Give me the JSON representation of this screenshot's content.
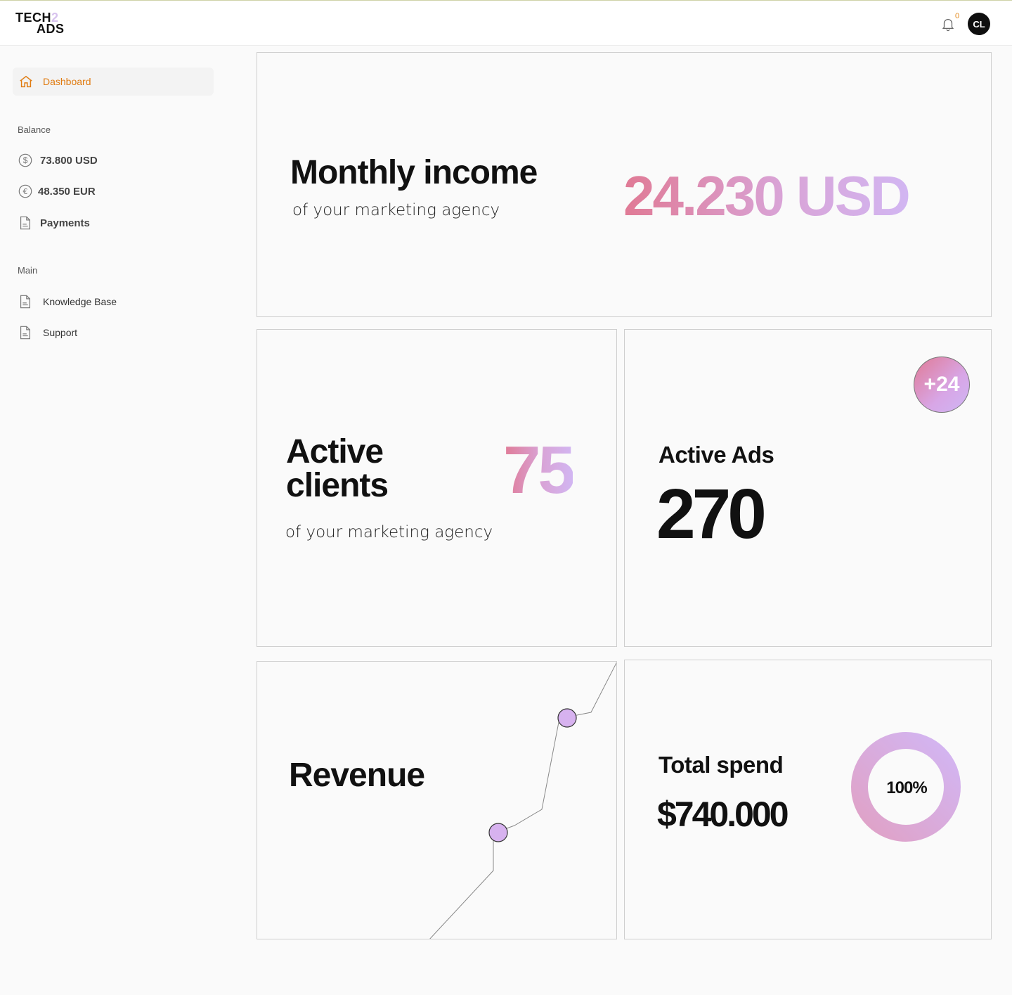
{
  "brand": {
    "line1": "TECH",
    "two": "2",
    "line2": "ADS"
  },
  "header": {
    "notification_count": "0",
    "avatar_initials": "CL"
  },
  "sidebar": {
    "active": {
      "label": "Dashboard"
    },
    "balance_title": "Balance",
    "balance_items": [
      {
        "label": "73.800 USD",
        "icon": "dollar-icon"
      },
      {
        "label": "48.350 EUR",
        "icon": "euro-icon"
      },
      {
        "label": "Payments",
        "icon": "document-icon"
      }
    ],
    "main_title": "Main",
    "main_items": [
      {
        "label": "Knowledge Base",
        "icon": "document-icon"
      },
      {
        "label": "Support",
        "icon": "document-icon"
      }
    ]
  },
  "monthly": {
    "title": "Monthly income",
    "subtitle": "of your marketing agency",
    "value": "24.230 USD"
  },
  "clients": {
    "title_line1": "Active",
    "title_line2": "clients",
    "value": "75",
    "subtitle": "of your marketing agency"
  },
  "ads": {
    "title": "Active Ads",
    "value": "270",
    "badge": "+24"
  },
  "revenue": {
    "title": "Revenue"
  },
  "spend": {
    "title": "Total spend",
    "value": "$740.000",
    "percent_label": "100%",
    "percent": 100
  },
  "colors": {
    "accent": "#e07b10",
    "gradient_start": "#e07a95",
    "gradient_end": "#d2b6f2"
  }
}
